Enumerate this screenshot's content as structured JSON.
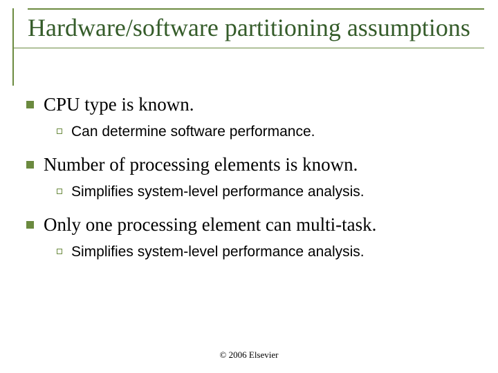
{
  "title": "Hardware/software partitioning assumptions",
  "bullets": [
    {
      "text": "CPU type is known.",
      "sub": [
        {
          "text": "Can determine software performance."
        }
      ]
    },
    {
      "text": "Number of processing elements is known.",
      "sub": [
        {
          "text": "Simplifies system-level performance analysis."
        }
      ]
    },
    {
      "text": "Only one processing element can multi-task.",
      "sub": [
        {
          "text": "Simplifies system-level performance analysis."
        }
      ]
    }
  ],
  "footer": "© 2006 Elsevier"
}
